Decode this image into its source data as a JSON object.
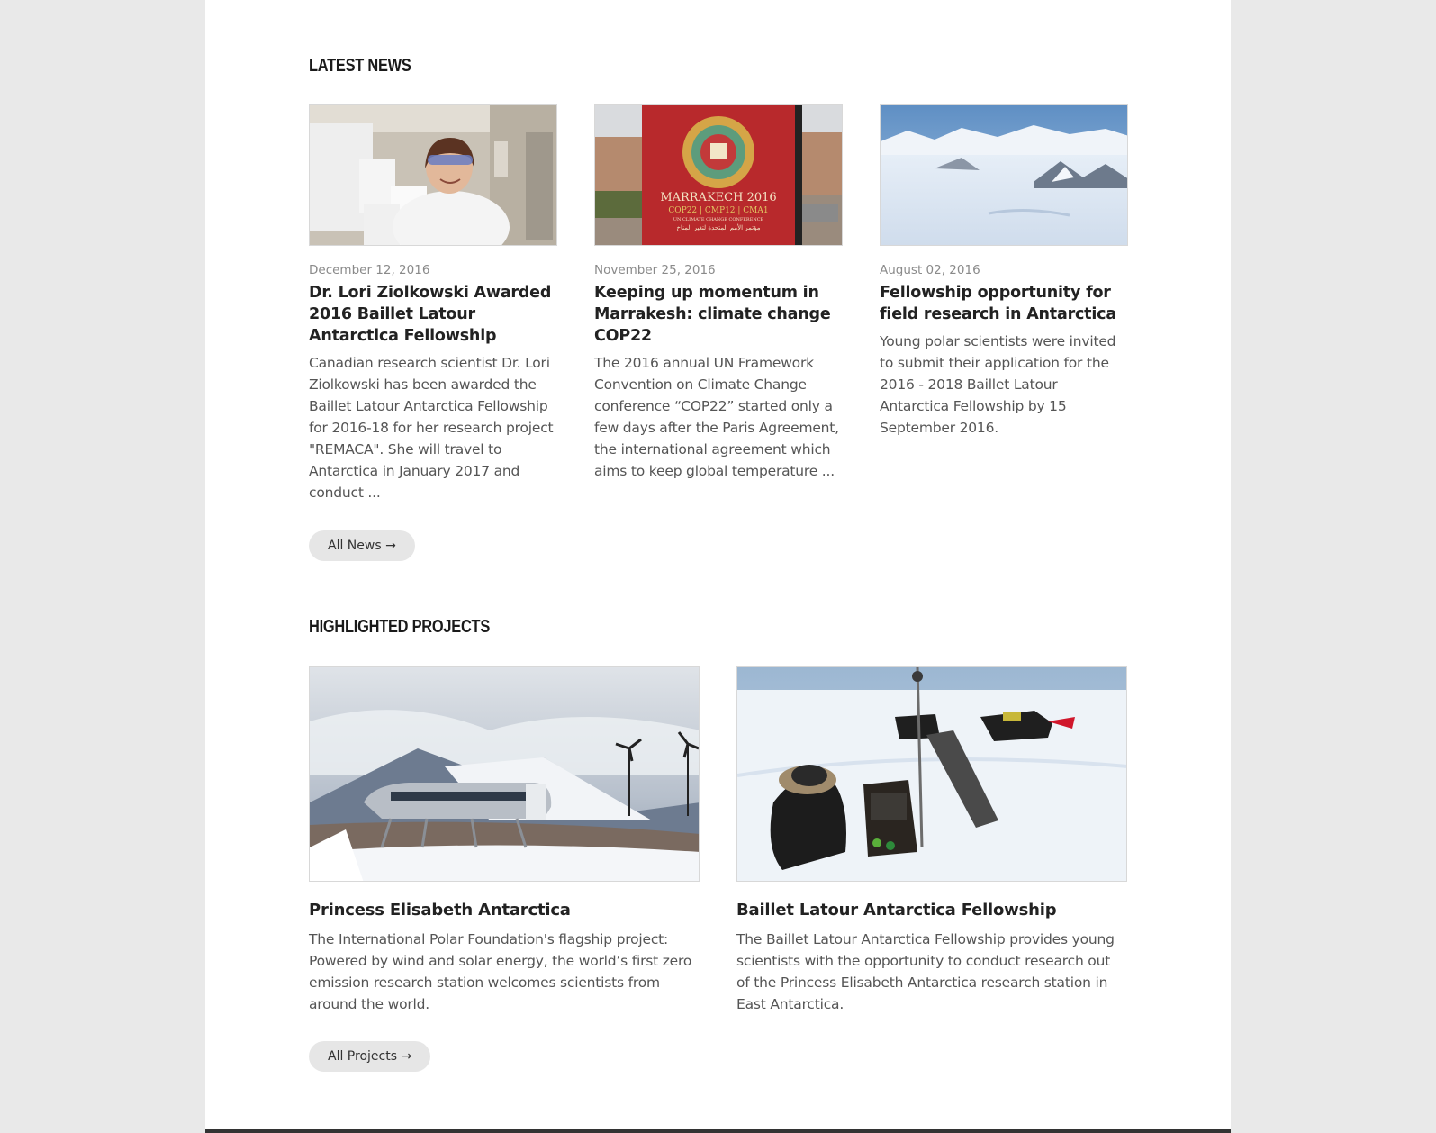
{
  "latest_news": {
    "heading": "LATEST NEWS",
    "items": [
      {
        "date": "December 12, 2016",
        "title": "Dr. Lori Ziolkowski Awarded 2016 Baillet Latour Antarctica Fellowship",
        "excerpt": "Canadian research scientist Dr. Lori Ziolkowski has been awarded the Baillet Latour Antarctica Fellowship for 2016-18 for her research project \"REMACA\". She will travel to Antarctica in January 2017 and conduct ..."
      },
      {
        "date": "November 25, 2016",
        "title": "Keeping up momentum in Marrakesh: climate change COP22",
        "excerpt": "The 2016 annual UN Framework Convention on Climate Change conference “COP22” started only a few days after the Paris Agreement, the international agreement which aims to keep global temperature ...",
        "image_text": {
          "line1": "MARRAKECH 2016",
          "line2": "COP22 | CMP12 | CMA1",
          "line3": "UN CLIMATE CHANGE CONFERENCE",
          "line4": "مؤتمر الأمم المتحدة لتغير المناخ"
        }
      },
      {
        "date": "August 02, 2016",
        "title": "Fellowship opportunity for field research in Antarctica",
        "excerpt": "Young polar scientists were invited to submit their application for the 2016 - 2018 Baillet Latour Antarctica Fellowship by 15 September 2016."
      }
    ],
    "all_link": "All News →"
  },
  "highlighted_projects": {
    "heading": "HIGHLIGHTED PROJECTS",
    "items": [
      {
        "title": "Princess Elisabeth Antarctica",
        "description": "The International Polar Foundation's flagship project: Powered by wind and solar energy, the world’s first zero emission research station welcomes scientists from around the world."
      },
      {
        "title": "Baillet Latour Antarctica Fellowship",
        "description": "The Baillet Latour Antarctica Fellowship provides young scientists with the opportunity to conduct research out of the Princess Elisabeth Antarctica research station in East Antarctica."
      }
    ],
    "all_link": "All Projects →"
  }
}
